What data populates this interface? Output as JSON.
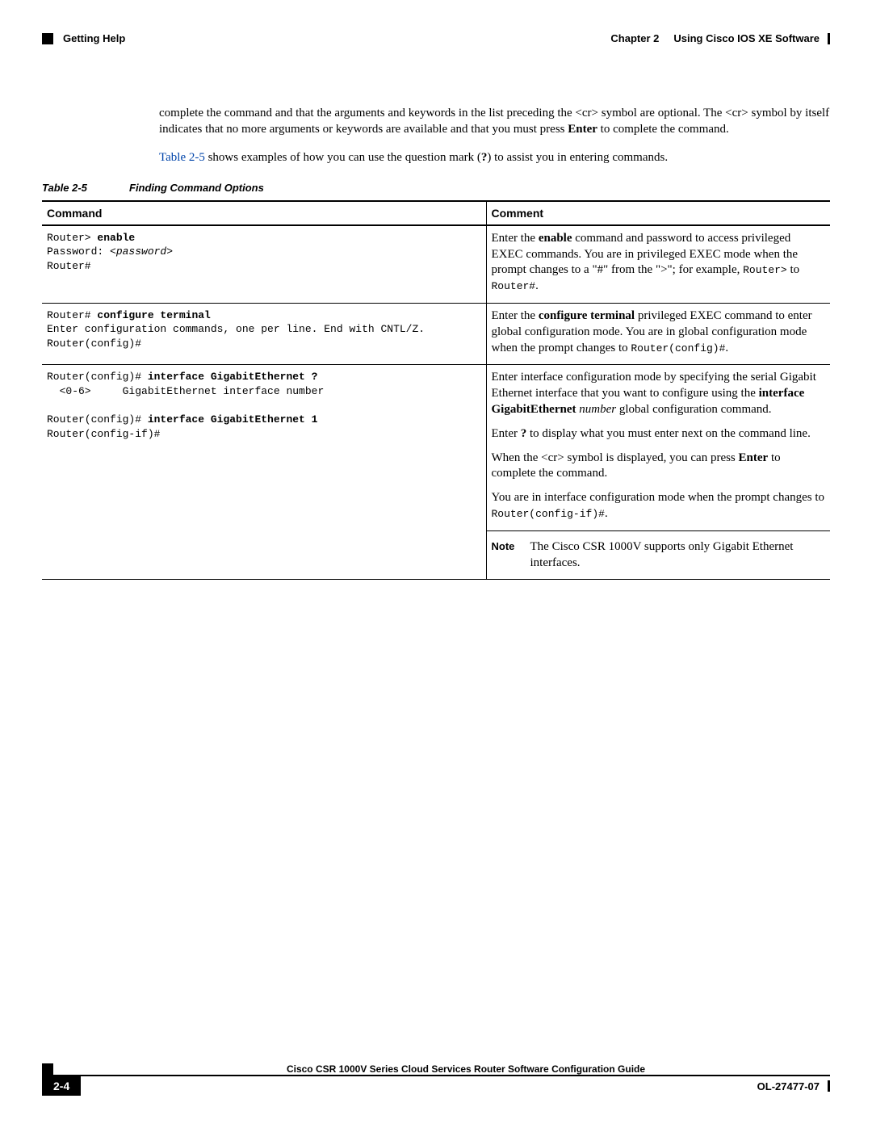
{
  "header": {
    "section": "Getting Help",
    "chapter_label": "Chapter 2",
    "chapter_title": "Using Cisco IOS XE Software"
  },
  "body": {
    "para1_pre": "complete the command and that the arguments and keywords in the list preceding the <cr> symbol are optional. The <cr> symbol by itself indicates that no more arguments or keywords are available and that you must press ",
    "para1_bold": "Enter",
    "para1_post": " to complete the command.",
    "para2_link": "Table 2-5",
    "para2_mid": " shows examples of how you can use the question mark (",
    "para2_bold": "?",
    "para2_post": ") to assist you in entering commands."
  },
  "table": {
    "caption_num": "Table 2-5",
    "caption_title": "Finding Command Options",
    "head_command": "Command",
    "head_comment": "Comment",
    "rows": [
      {
        "cmd_r1_p": "Router> ",
        "cmd_r1_b": "enable",
        "cmd_r2_p": "Password: ",
        "cmd_r2_i": "<password>",
        "cmd_r3": "Router#",
        "com_pre": "Enter the ",
        "com_b": "enable",
        "com_mid": " command and password to access privileged EXEC commands. You are in privileged EXEC mode when the prompt changes to a \"#\" from the \">\"; for example, ",
        "com_m1": "Router>",
        "com_to": " to ",
        "com_m2": "Router#",
        "com_end": "."
      },
      {
        "cmd_r1_p": "Router# ",
        "cmd_r1_b": "configure terminal",
        "cmd_r2": "Enter configuration commands, one per line. End with CNTL/Z.",
        "cmd_r3": "Router(config)#",
        "com_pre": "Enter the ",
        "com_b": "configure terminal",
        "com_mid": " privileged EXEC command to enter global configuration mode. You are in global configuration mode when the prompt changes to ",
        "com_m1": "Router(config)#",
        "com_end": "."
      },
      {
        "cmd_r1_p": "Router(config)# ",
        "cmd_r1_b": "interface GigabitEthernet ?",
        "cmd_r2_a": "  <0-6>",
        "cmd_r2_b": "     GigabitEthernet interface number",
        "cmd_blank": "",
        "cmd_r3_p": "Router(config)# ",
        "cmd_r3_b": "interface GigabitEthernet 1",
        "cmd_r4": "Router(config-if)#",
        "com1_pre": "Enter interface configuration mode by specifying the serial Gigabit Ethernet interface that you want to configure using the ",
        "com1_b": "interface GigabitEthernet",
        "com1_sp": " ",
        "com1_i": "number",
        "com1_post": " global configuration command.",
        "com2_pre": "Enter ",
        "com2_b": "?",
        "com2_post": " to display what you must enter next on the command line.",
        "com3_pre": "When the <cr> symbol is displayed, you can press ",
        "com3_b": "Enter",
        "com3_post": " to complete the command.",
        "com4_pre": "You are in interface configuration mode when the prompt changes to ",
        "com4_m": "Router(config-if)#",
        "com4_end": ".",
        "note_label": "Note",
        "note_body": "The Cisco CSR 1000V supports only Gigabit Ethernet interfaces."
      }
    ]
  },
  "footer": {
    "title": "Cisco CSR 1000V Series Cloud Services Router Software Configuration Guide",
    "page": "2-4",
    "doc_id": "OL-27477-07"
  }
}
